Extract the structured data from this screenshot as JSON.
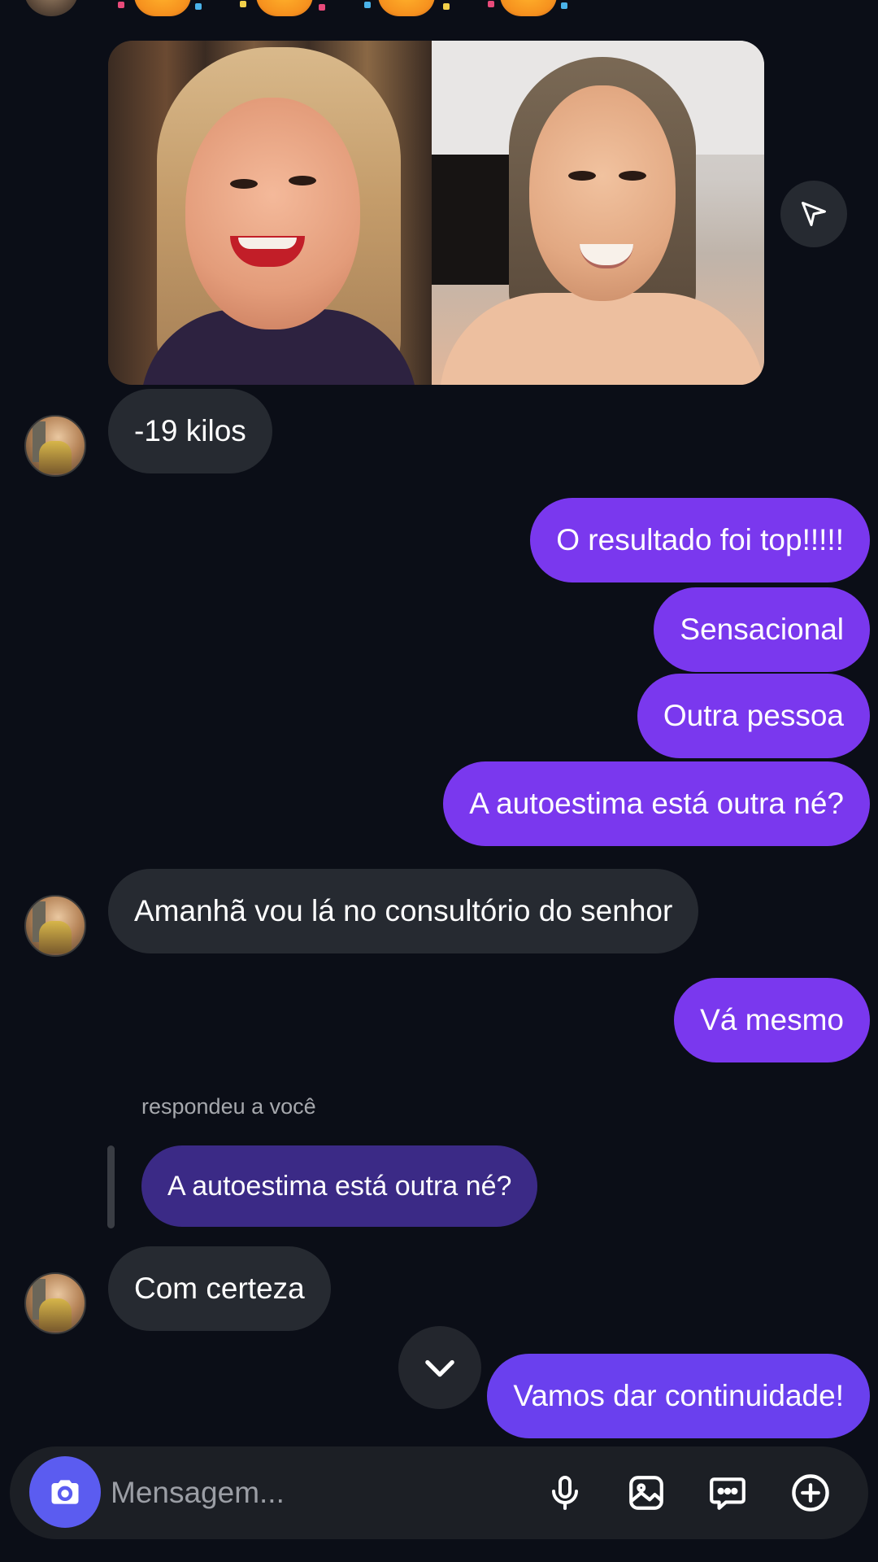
{
  "colors": {
    "background": "#0b0e17",
    "incoming_bubble": "#262a31",
    "outgoing_bubble": "#7a38ee",
    "reply_bubble": "#3b2a86",
    "camera_button": "#5b5cf0"
  },
  "shared_post": {
    "icon": "send-icon"
  },
  "messages": [
    {
      "direction": "incoming",
      "text": "-19 kilos"
    },
    {
      "direction": "outgoing",
      "text": "O resultado foi top!!!!!"
    },
    {
      "direction": "outgoing",
      "text": "Sensacional"
    },
    {
      "direction": "outgoing",
      "text": "Outra pessoa"
    },
    {
      "direction": "outgoing",
      "text": "A autoestima está outra né?"
    },
    {
      "direction": "incoming",
      "text": "Amanhã vou lá no consultório do senhor"
    },
    {
      "direction": "outgoing",
      "text": "Vá mesmo"
    },
    {
      "direction": "incoming",
      "text": "Com certeza"
    },
    {
      "direction": "outgoing",
      "text": "Vamos dar continuidade!"
    }
  ],
  "reply": {
    "label": "respondeu a você",
    "quoted_text": "A autoestima está outra né?"
  },
  "composer": {
    "placeholder": "Mensagem...",
    "icons": [
      "camera-icon",
      "microphone-icon",
      "gallery-icon",
      "sticker-icon",
      "plus-icon"
    ]
  }
}
